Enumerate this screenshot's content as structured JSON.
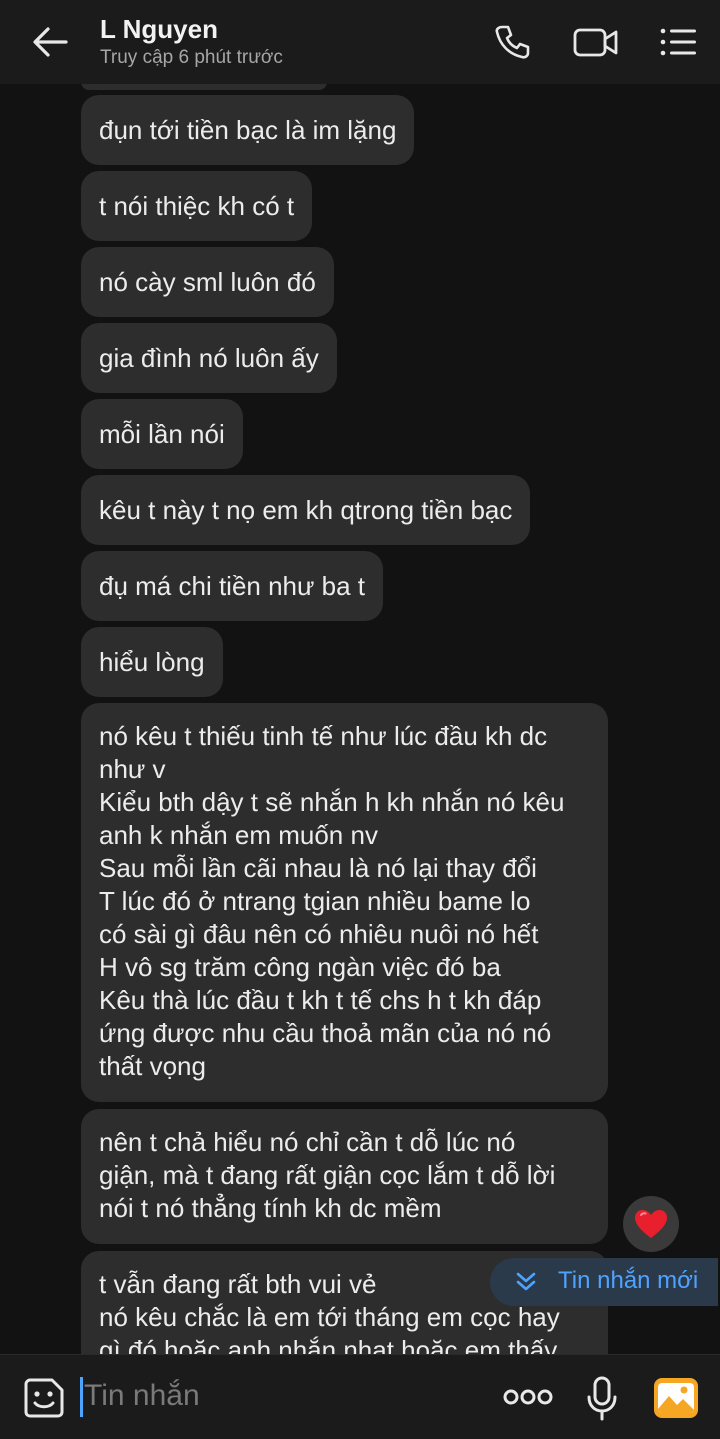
{
  "header": {
    "contact_name": "L Nguyen",
    "status": "Truy cập 6 phút trước",
    "icons": [
      "back-arrow-icon",
      "phone-icon",
      "video-call-icon",
      "menu-list-icon"
    ]
  },
  "messages": [
    {
      "lines": [
        "đụn tới tiền bạc là im lặng"
      ]
    },
    {
      "lines": [
        "t nói thiệc kh có t"
      ]
    },
    {
      "lines": [
        "nó cày sml luôn đó"
      ]
    },
    {
      "lines": [
        "gia đình nó luôn ấy"
      ]
    },
    {
      "lines": [
        "mỗi lần nói"
      ]
    },
    {
      "lines": [
        "kêu t này t nọ em kh qtrong tiền bạc"
      ]
    },
    {
      "lines": [
        "đụ má chi tiền như ba t"
      ]
    },
    {
      "lines": [
        "hiểu lòng"
      ]
    },
    {
      "lines": [
        "nó kêu t thiếu tinh tế như lúc đầu kh dc",
        "như v",
        "Kiểu bth dậy t sẽ nhắn h kh nhắn nó kêu",
        "anh k nhắn em muốn nv",
        "Sau mỗi lần cãi nhau là nó lại thay đổi",
        "T lúc đó ở ntrang tgian nhiều bame lo",
        "có sài gì đâu nên có nhiêu nuôi nó hết",
        "H vô sg trăm công ngàn việc đó ba",
        "Kêu thà lúc đầu t kh t tế chs h t kh đáp",
        "ứng được nhu cầu thoả mãn của nó nó",
        "thất vọng"
      ]
    },
    {
      "lines": [
        "nên t chả hiểu nó chỉ cần t dỗ lúc nó",
        "giận, mà t đang rất giận cọc lắm t dỗ lời",
        "nói t nó thẳng tính kh dc mềm"
      ],
      "reaction": "heart"
    },
    {
      "lines": [
        "t vẫn đang rất bth vui vẻ",
        "nó kêu chắc là em tới tháng em cọc hay",
        "gì đó hoặc anh nhắn nhạt hoặc em thấy"
      ]
    }
  ],
  "new_message_pill": {
    "label": "Tin nhắn mới",
    "icon": "double-chevron-down-icon"
  },
  "composer": {
    "placeholder": "Tin nhắn",
    "icons": [
      "sticker-icon",
      "more-dots-icon",
      "microphone-icon",
      "gallery-icon"
    ]
  },
  "colors": {
    "accent": "#4ea3ff",
    "bubble": "#2d2d2d",
    "background": "#121212",
    "heart": "#e8202e"
  }
}
